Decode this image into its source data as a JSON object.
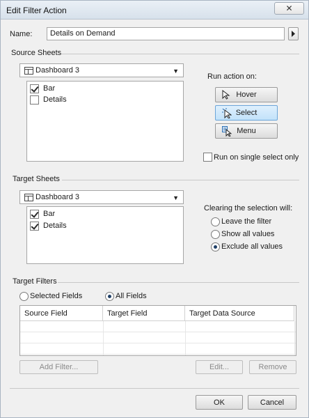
{
  "window": {
    "title": "Edit Filter Action"
  },
  "name": {
    "label": "Name:",
    "value": "Details on Demand"
  },
  "source": {
    "section_label": "Source Sheets",
    "dropdown_value": "Dashboard 3",
    "items": [
      {
        "label": "Bar",
        "checked": true
      },
      {
        "label": "Details",
        "checked": false
      }
    ]
  },
  "run_action": {
    "label": "Run action on:",
    "hover": "Hover",
    "select": "Select",
    "menu": "Menu",
    "selected": "select",
    "single_select_label": "Run on single select only",
    "single_select_checked": false
  },
  "target": {
    "section_label": "Target Sheets",
    "dropdown_value": "Dashboard 3",
    "items": [
      {
        "label": "Bar",
        "checked": true
      },
      {
        "label": "Details",
        "checked": true
      }
    ]
  },
  "clearing": {
    "label": "Clearing the selection will:",
    "options": [
      "Leave the filter",
      "Show all values",
      "Exclude all values"
    ],
    "selected_index": 2
  },
  "target_filters": {
    "section_label": "Target Filters",
    "selected_fields_label": "Selected Fields",
    "all_fields_label": "All Fields",
    "selected": "all",
    "columns": [
      "Source Field",
      "Target Field",
      "Target Data Source"
    ],
    "add_filter_label": "Add Filter...",
    "edit_label": "Edit...",
    "remove_label": "Remove"
  },
  "footer": {
    "ok_label": "OK",
    "cancel_label": "Cancel"
  },
  "icons": {
    "close": "close-icon",
    "dashboard": "dashboard-icon",
    "arrow_right": "arrow-right-icon",
    "hover": "cursor-icon",
    "select": "select-cursor-icon",
    "menu": "menu-cursor-icon"
  }
}
